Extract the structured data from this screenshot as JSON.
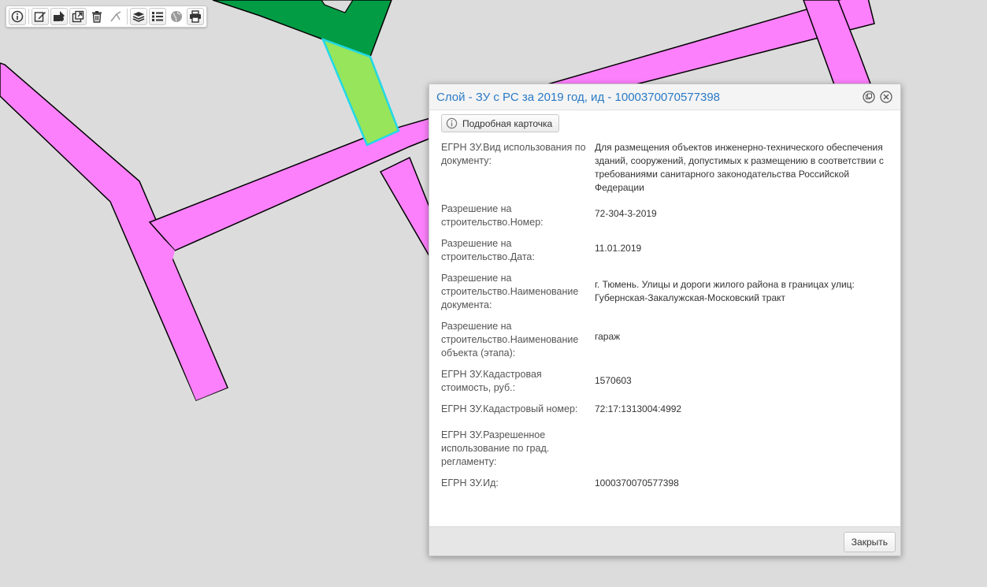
{
  "map": {
    "parcel_colors": {
      "road": "#fc80fb",
      "green_zone": "#029c45",
      "selected": "#96e55a",
      "selected_outline": "#21d8e8",
      "background": "#dcdcdc"
    }
  },
  "toolbar": {
    "groups": [
      [
        "info-icon",
        "edit-icon",
        "shapes-icon",
        "export-icon",
        "trash-icon",
        "measure-icon"
      ],
      [
        "layers-icon",
        "list-icon",
        "globe-icon",
        "print-icon"
      ]
    ]
  },
  "popup": {
    "title": "Слой - ЗУ с РС за 2019 год, ид - 1000370070577398",
    "card_button_label": "Подробная карточка",
    "close_button_label": "Закрыть",
    "fields": [
      {
        "label": "ЕГРН ЗУ.Вид использования по документу:",
        "value": "Для размещения объектов инженерно-технического обеспечения зданий, сооружений, допустимых к размещению в соответствии с требованиями санитарного законодательства Российской Федерации"
      },
      {
        "label": "Разрешение на строительство.Номер:",
        "value": "72-304-3-2019"
      },
      {
        "label": "Разрешение на строительство.Дата:",
        "value": "11.01.2019"
      },
      {
        "label": "Разрешение на строительство.Наименование документа:",
        "value": "г. Тюмень. Улицы и дороги жилого района в границах улиц: Губернская-Закалужская-Московский тракт"
      },
      {
        "label": "Разрешение на строительство.Наименование объекта (этапа):",
        "value": "гараж"
      },
      {
        "label": "ЕГРН ЗУ.Кадастровая стоимость, руб.:",
        "value": "1570603"
      },
      {
        "label": "ЕГРН ЗУ.Кадастровый номер:",
        "value": "72:17:1313004:4992"
      },
      {
        "label": "ЕГРН ЗУ.Разрешенное использование по град. регламенту:",
        "value": ""
      },
      {
        "label": "ЕГРН ЗУ.Ид:",
        "value": "1000370070577398"
      }
    ]
  }
}
